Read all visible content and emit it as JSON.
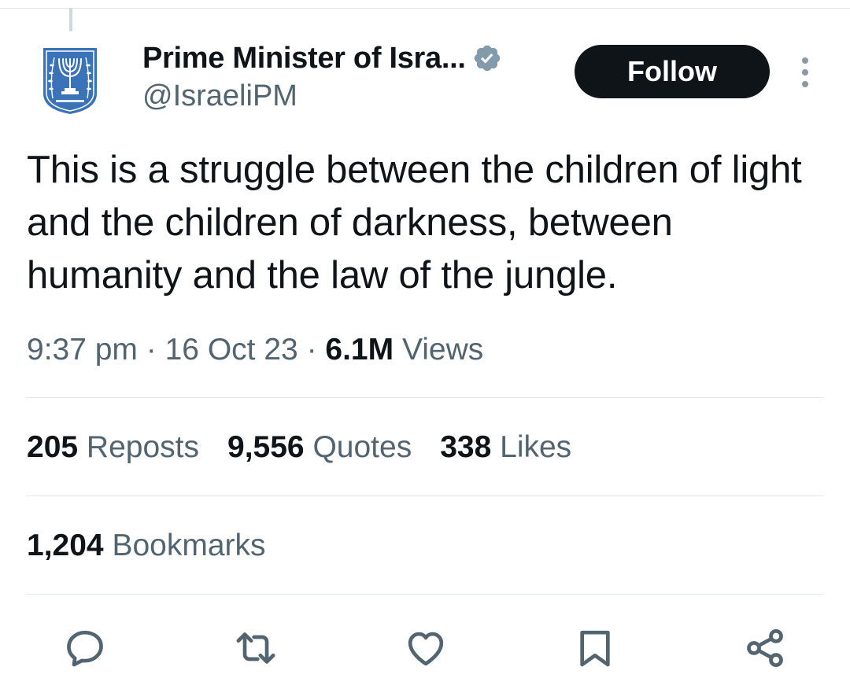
{
  "author": {
    "display_name": "Prime Minister of Isra...",
    "handle": "@IsraeliPM",
    "avatar_icon": "state-emblem-menorah-icon",
    "verified_icon": "verified-badge-icon",
    "verified_color": "#829aab"
  },
  "follow_button": {
    "label": "Follow",
    "bg_color": "#0f1419"
  },
  "more_icon": "more-vertical-icon",
  "tweet": {
    "text": "This is a struggle between the children of light and the children of darkness, between humanity and the law of the jungle.",
    "time": "9:37 pm",
    "date": "16 Oct 23",
    "separator": "·",
    "views_count": "6.1M",
    "views_label": "Views"
  },
  "stats": {
    "reposts": {
      "count": "205",
      "label": "Reposts"
    },
    "quotes": {
      "count": "9,556",
      "label": "Quotes"
    },
    "likes": {
      "count": "338",
      "label": "Likes"
    },
    "bookmarks": {
      "count": "1,204",
      "label": "Bookmarks"
    }
  },
  "actions": [
    {
      "icon": "reply-icon"
    },
    {
      "icon": "repost-icon"
    },
    {
      "icon": "like-icon"
    },
    {
      "icon": "bookmark-icon"
    },
    {
      "icon": "share-icon"
    }
  ],
  "colors": {
    "text_primary": "#0f1419",
    "text_secondary": "#536471",
    "divider": "#e1e6ea",
    "emblem_blue": "#3a73b8"
  }
}
